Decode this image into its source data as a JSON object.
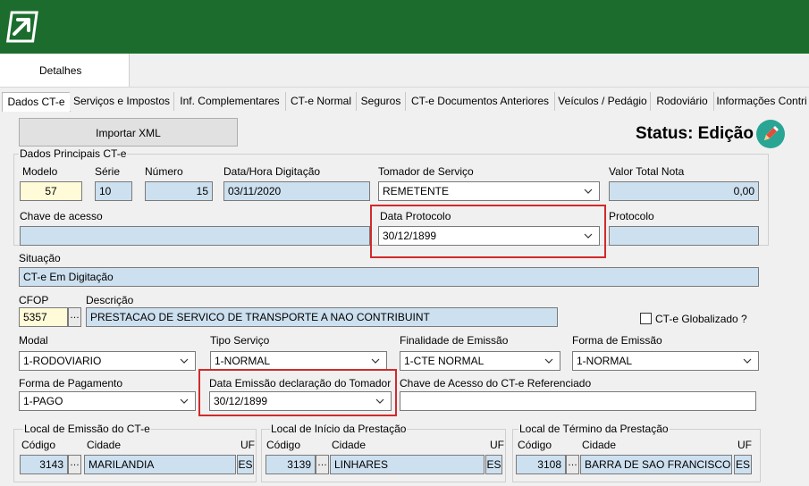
{
  "tabs": {
    "detalhes": "Detalhes",
    "items": [
      "Dados CT-e",
      "Serviços e Impostos",
      "Inf. Complementares",
      "CT-e Normal",
      "Seguros",
      "CT-e Documentos Anteriores",
      "Veículos / Pedágio",
      "Rodoviário",
      "Informações Contri"
    ]
  },
  "toolbar": {
    "import_label": "Importar XML"
  },
  "status": {
    "text": "Status: Edição"
  },
  "principais": {
    "group_label": "Dados Principais CT-e",
    "modelo_label": "Modelo",
    "modelo": "57",
    "serie_label": "Série",
    "serie": "10",
    "numero_label": "Número",
    "numero": "15",
    "data_digitacao_label": "Data/Hora Digitação",
    "data_digitacao": "03/11/2020",
    "tomador_label": "Tomador de Serviço",
    "tomador": "REMETENTE",
    "valor_total_label": "Valor Total Nota",
    "valor_total": "0,00",
    "chave_label": "Chave de acesso",
    "chave": "",
    "data_protocolo_label": "Data Protocolo",
    "data_protocolo": "30/12/1899",
    "protocolo_label": "Protocolo",
    "protocolo": ""
  },
  "situacao": {
    "label": "Situação",
    "value": "CT-e Em Digitação"
  },
  "cfop": {
    "label": "CFOP",
    "value": "5357",
    "descricao_label": "Descrição",
    "descricao": "PRESTACAO DE SERVICO DE TRANSPORTE A NAO CONTRIBUINT",
    "globalizado_label": "CT-e Globalizado ?"
  },
  "modal": {
    "label": "Modal",
    "value": "1-RODOVIARIO"
  },
  "tipo_servico": {
    "label": "Tipo Serviço",
    "value": "1-NORMAL"
  },
  "finalidade": {
    "label": "Finalidade de Emissão",
    "value": "1-CTE NORMAL"
  },
  "forma_emissao": {
    "label": "Forma de Emissão",
    "value": "1-NORMAL"
  },
  "forma_pagamento": {
    "label": "Forma de Pagamento",
    "value": "1-PAGO"
  },
  "data_emissao_tomador": {
    "label": "Data Emissão declaração do Tomador",
    "value": "30/12/1899"
  },
  "chave_referenciado": {
    "label": "Chave de Acesso do CT-e Referenciado",
    "value": ""
  },
  "locais": [
    {
      "title": "Local de Emissão do CT-e",
      "codigo_label": "Código",
      "cidade_label": "Cidade",
      "uf_label": "UF",
      "codigo": "3143",
      "cidade": "MARILANDIA",
      "uf": "ES"
    },
    {
      "title": "Local de Início da Prestação",
      "codigo_label": "Código",
      "cidade_label": "Cidade",
      "uf_label": "UF",
      "codigo": "3139",
      "cidade": "LINHARES",
      "uf": "ES"
    },
    {
      "title": "Local de Término da Prestação",
      "codigo_label": "Código",
      "cidade_label": "Cidade",
      "uf_label": "UF",
      "codigo": "3108",
      "cidade": "BARRA DE SAO FRANCISCO",
      "uf": "ES"
    }
  ]
}
